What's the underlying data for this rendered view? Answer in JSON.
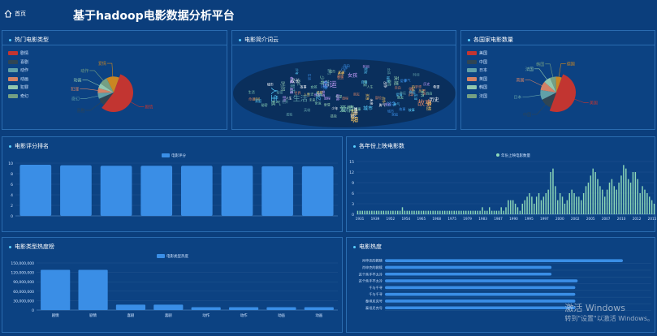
{
  "header": {
    "home_label": "首页",
    "title": "基于hadoop电影数据分析平台"
  },
  "panels": {
    "genre": {
      "title": "热门电影类型"
    },
    "cloud": {
      "title": "电影简介词云"
    },
    "country": {
      "title": "各国家电影数量"
    },
    "rating": {
      "title": "电影评分排名"
    },
    "yearly": {
      "title": "各年份上映电影数"
    },
    "genreHeat": {
      "title": "电影类型热度榜"
    },
    "movieHeat": {
      "title": "电影热度"
    }
  },
  "colors": {
    "bar": "#3a8ee6",
    "line": "#8ed8b8",
    "pie": [
      "#c23531",
      "#2f4554",
      "#61a0a8",
      "#d48265",
      "#91c7ae",
      "#749f83",
      "#ca8622",
      "#bda29a"
    ]
  },
  "genre_legend": [
    "剧情",
    "喜剧",
    "动作",
    "动画",
    "犯罪",
    "奇幻"
  ],
  "genre_pie_labels": [
    "剧情",
    "喜剧",
    "奇幻",
    "犯罪",
    "动画",
    "动作",
    "爱情"
  ],
  "country_legend": [
    "美国",
    "中国",
    "日本",
    "英国",
    "韩国",
    "法国"
  ],
  "country_pie_labels": [
    "美国",
    "中国",
    "日本",
    "英国",
    "法国",
    "韩国",
    "德国"
  ],
  "cloud_words": [
    "人生",
    "爱情",
    "故事",
    "生活",
    "命运",
    "世界",
    "时间",
    "历史",
    "战争",
    "城市",
    "少年",
    "家庭",
    "朋友",
    "女孩",
    "梦想",
    "英雄",
    "成长",
    "未来",
    "记忆",
    "勇气",
    "自由",
    "秘密",
    "冒险",
    "旅程",
    "孤独",
    "希望"
  ],
  "chart_data": [
    {
      "id": "rating",
      "type": "bar",
      "title": "电影评分排名",
      "series": [
        {
          "name": "电影评分",
          "values": [
            9.7,
            9.6,
            9.5,
            9.5,
            9.5,
            9.5,
            9.4,
            9.4
          ]
        }
      ],
      "categories": [
        "",
        "",
        "",
        "",
        "",
        "",
        "",
        ""
      ],
      "ylim": [
        0,
        10
      ],
      "yticks": [
        0,
        2,
        4,
        6,
        8,
        10
      ]
    },
    {
      "id": "yearly",
      "type": "bar",
      "title": "各年份上映电影数",
      "series": [
        {
          "name": "年份上映电影数量",
          "values": [
            1,
            1,
            1,
            1,
            1,
            1,
            1,
            1,
            1,
            1,
            1,
            1,
            1,
            1,
            1,
            1,
            1,
            1,
            1,
            2,
            1,
            1,
            1,
            1,
            1,
            1,
            1,
            1,
            1,
            1,
            1,
            1,
            1,
            1,
            1,
            1,
            1,
            1,
            1,
            1,
            1,
            1,
            1,
            1,
            1,
            1,
            1,
            1,
            1,
            1,
            1,
            1,
            1,
            2,
            1,
            1,
            2,
            1,
            1,
            1,
            1,
            2,
            1,
            2,
            4,
            4,
            4,
            3,
            2,
            1,
            3,
            4,
            5,
            6,
            5,
            3,
            5,
            6,
            4,
            5,
            6,
            7,
            12,
            13,
            8,
            4,
            6,
            5,
            3,
            4,
            6,
            7,
            6,
            5,
            5,
            4,
            6,
            8,
            9,
            11,
            13,
            12,
            10,
            8,
            7,
            5,
            7,
            9,
            10,
            8,
            7,
            9,
            11,
            14,
            13,
            10,
            9,
            12,
            12,
            10,
            6,
            8,
            7,
            6,
            5,
            4,
            3
          ]
        }
      ],
      "categories": [
        "1931",
        "1932",
        "1933",
        "1934",
        "1935",
        "1936",
        "1937",
        "1938",
        "1939",
        "1940",
        "1941",
        "1942",
        "1943",
        "1944",
        "1945",
        "1946",
        "1947",
        "1948",
        "1949",
        "1950",
        "1951",
        "1952",
        "1953",
        "1954",
        "1955",
        "1956",
        "1957",
        "1958",
        "1959",
        "1960",
        "1961",
        "1962",
        "1963",
        "1964",
        "1965",
        "1966",
        "1967",
        "1968",
        "1969",
        "1970",
        "1971",
        "1972",
        "1973",
        "1974",
        "1975",
        "1976",
        "1977",
        "1978",
        "1979",
        "1980",
        "1981",
        "1982",
        "1983",
        "1984",
        "1985",
        "1986",
        "1987",
        "1988",
        "1989",
        "1990",
        "1991",
        "1992",
        "1993",
        "1994",
        "1995",
        "1996",
        "1997",
        "1998",
        "1999",
        "2000",
        "2001",
        "2002",
        "2003",
        "2004",
        "2005",
        "2006",
        "2007",
        "2008",
        "2009",
        "2010",
        "2011",
        "2012",
        "2013",
        "2014",
        "2015",
        "2016"
      ],
      "xtick_labels": [
        "1931",
        "1939",
        "1952",
        "1954",
        "1965",
        "1968",
        "1975",
        "1979",
        "1983",
        "1987",
        "1990",
        "1995",
        "1997",
        "2000",
        "2002",
        "2005",
        "2007",
        "2010",
        "2012",
        "2015"
      ],
      "ylim": [
        0,
        15
      ],
      "yticks": [
        0,
        3,
        6,
        9,
        12,
        15
      ]
    },
    {
      "id": "genreHeat",
      "type": "bar",
      "title": "电影类型热度榜",
      "series": [
        {
          "name": "电影类型热度",
          "values": [
            128000000,
            128000000,
            17000000,
            17000000,
            9000000,
            9000000,
            9000000,
            9000000
          ]
        }
      ],
      "categories": [
        "剧情",
        "剧情",
        "喜剧",
        "喜剧",
        "动作",
        "动作",
        "动画",
        "动画"
      ],
      "ylim": [
        0,
        150000000
      ],
      "yticks": [
        "0",
        "30,000,000",
        "60,000,000",
        "90,000,000",
        "120,000,000",
        "150,000,000"
      ]
    },
    {
      "id": "movieHeat",
      "type": "bar-horizontal",
      "title": "电影热度",
      "categories": [
        "肖申克的救赎",
        "肖申克的救赎",
        "这个杀手不太冷",
        "这个杀手不太冷",
        "千与千寻",
        "千与千寻",
        "泰坦尼克号",
        "泰坦尼克号"
      ],
      "values": [
        100,
        70,
        70,
        81,
        80,
        80,
        80,
        80
      ]
    },
    {
      "id": "genrePie",
      "type": "pie",
      "title": "热门电影类型",
      "categories": [
        "剧情",
        "喜剧",
        "奇幻",
        "犯罪",
        "动画",
        "动作",
        "爱情"
      ],
      "values": [
        55,
        8,
        6,
        5,
        5,
        8,
        13
      ]
    },
    {
      "id": "countryPie",
      "type": "pie",
      "title": "各国家电影数量",
      "categories": [
        "美国",
        "中国",
        "日本",
        "英国",
        "法国",
        "韩国",
        "德国"
      ],
      "values": [
        50,
        12,
        10,
        9,
        7,
        6,
        6
      ]
    }
  ],
  "watermark": {
    "line1": "激活 Windows",
    "line2": "转到\"设置\"以激活 Windows。"
  }
}
